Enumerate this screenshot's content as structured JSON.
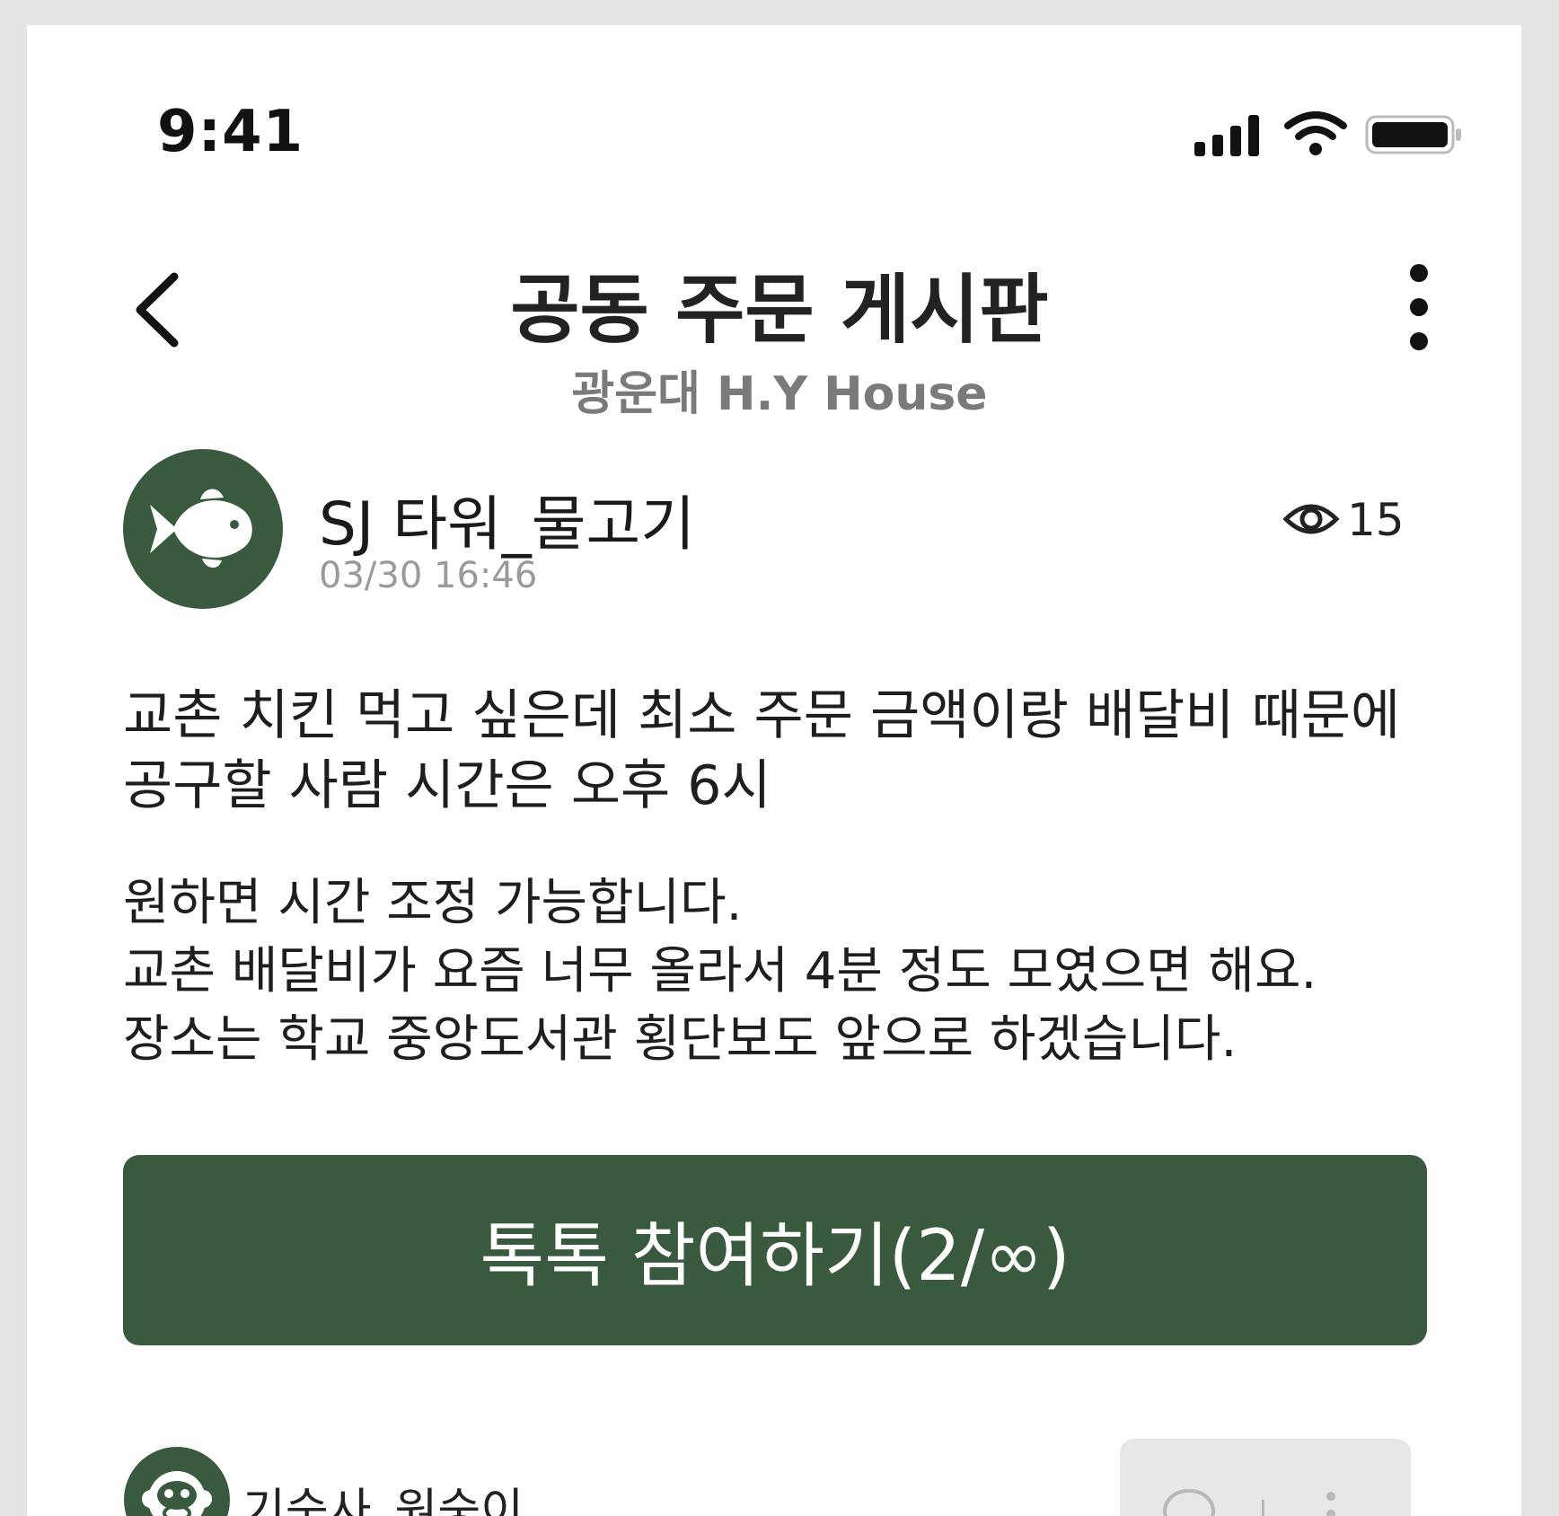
{
  "status_bar": {
    "time": "9:41"
  },
  "header": {
    "title": "공동 주문 게시판",
    "subtitle": "광운대 H.Y House"
  },
  "post": {
    "author": "SJ 타워_물고기",
    "time": "03/30 16:46",
    "views": "15",
    "body": "교촌 치킨 먹고 싶은데 최소 주문 금액이랑 배달비 때문에 공구할 사람 시간은 오후 6시",
    "detail_lines": [
      "원하면 시간 조정 가능합니다.",
      "교촌 배달비가 요즘 너무 올라서 4분 정도 모였으면 해요.",
      "장소는 학교 중앙도서관 횡단보도 앞으로 하겠습니다."
    ]
  },
  "join_button": {
    "label": "톡톡 참여하기(2/∞)"
  },
  "comment": {
    "author": "기숙사_원숭이"
  },
  "icons": {
    "back": "chevron-left-icon",
    "more": "more-vertical-icon",
    "author_avatar": "fish-icon",
    "views": "eye-icon",
    "comment_avatar": "monkey-icon",
    "reply": "speech-bubble-icon",
    "comment_more": "more-vertical-icon"
  },
  "colors": {
    "accent": "#3a5a40",
    "background": "#ffffff",
    "frame": "#e4e4e4",
    "muted_text": "#9a9a9a"
  }
}
